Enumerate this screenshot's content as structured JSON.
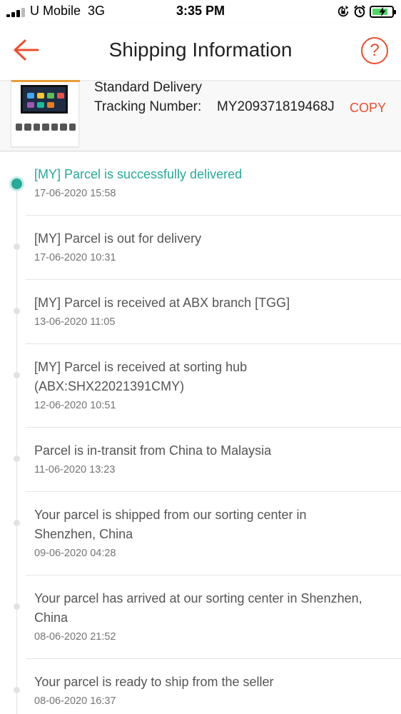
{
  "status_bar": {
    "carrier": "U Mobile",
    "network": "3G",
    "time": "3:35 PM",
    "icons": [
      "signal-icon",
      "rotation-lock-icon",
      "alarm-icon",
      "battery-charging-icon"
    ]
  },
  "header": {
    "title": "Shipping Information",
    "back_icon": "back-arrow-icon",
    "help_label": "?"
  },
  "order": {
    "delivery_type": "Standard Delivery",
    "tracking_label": "Tracking Number:",
    "tracking_number": "MY209371819468J",
    "copy_label": "COPY"
  },
  "colors": {
    "accent": "#ee4d2d",
    "delivered": "#26aa99"
  },
  "events": [
    {
      "message": "[MY] Parcel is successfully delivered",
      "time": "17-06-2020 15:58"
    },
    {
      "message": "[MY] Parcel is out for delivery",
      "time": "17-06-2020 10:31"
    },
    {
      "message": "[MY] Parcel is received at ABX branch [TGG]",
      "time": "13-06-2020 11:05"
    },
    {
      "message": "[MY] Parcel is received at sorting hub (ABX:SHX22021391CMY)",
      "time": "12-06-2020 10:51"
    },
    {
      "message": "Parcel is in-transit from China to Malaysia",
      "time": "11-06-2020 13:23"
    },
    {
      "message": "Your parcel is shipped from our sorting center in Shenzhen, China",
      "time": "09-06-2020 04:28"
    },
    {
      "message": "Your parcel has arrived at our sorting center in Shenzhen, China",
      "time": "08-06-2020 21:52"
    },
    {
      "message": "Your parcel is ready to ship from the seller",
      "time": "08-06-2020 16:37"
    }
  ]
}
